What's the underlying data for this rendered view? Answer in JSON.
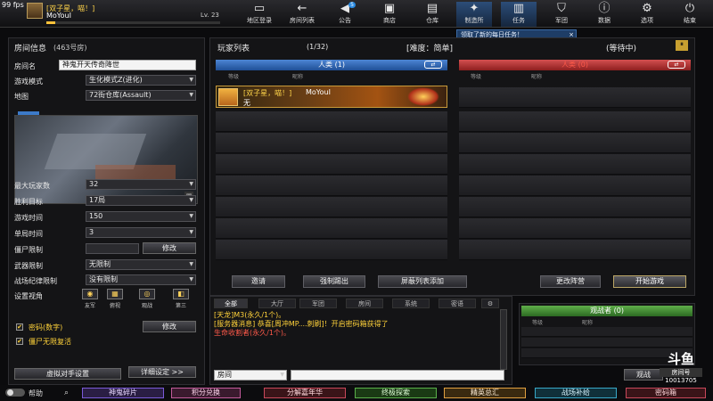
{
  "fps": "99 fps",
  "player": {
    "tag": "[双子星，喵！]",
    "name": "MoYouI",
    "level": "Lv. 23",
    "exp_fraction": 0.05
  },
  "nav": [
    {
      "label": "地区登录",
      "icon": "monitor-icon",
      "glyph": "▭"
    },
    {
      "label": "房间列表",
      "icon": "back-arrow-icon",
      "glyph": "←"
    },
    {
      "label": "公告",
      "icon": "megaphone-icon",
      "glyph": "◀",
      "badge": "5"
    },
    {
      "label": "商店",
      "icon": "shop-icon",
      "glyph": "▣"
    },
    {
      "label": "仓库",
      "icon": "briefcase-icon",
      "glyph": "▤"
    },
    {
      "label": "制造所",
      "icon": "factory-icon",
      "glyph": "✦"
    },
    {
      "label": "任务",
      "icon": "quest-icon",
      "glyph": "▥"
    },
    {
      "label": "军团",
      "icon": "shield-icon",
      "glyph": "⛉"
    },
    {
      "label": "数据",
      "icon": "info-icon",
      "glyph": "ⓘ"
    },
    {
      "label": "选项",
      "icon": "gear-icon",
      "glyph": "⚙"
    },
    {
      "label": "结束",
      "icon": "power-icon",
      "glyph": "⏻"
    }
  ],
  "quest_tip": {
    "text": "领取了新的每日任务！",
    "close": "×"
  },
  "room": {
    "title": "房间信息",
    "room_no": "(463号房)",
    "name_label": "房间名",
    "name_value": "神鬼开天传奇降世",
    "mode_label": "游戏模式",
    "mode_value": "生化模式Z(进化)",
    "map_label": "地图",
    "map_value": "72街仓库(Assault)",
    "max_players_label": "最大玩家数",
    "max_players_value": "32",
    "win_target_label": "胜利目标",
    "win_target_value": "17局",
    "game_time_label": "游戏时间",
    "game_time_value": "150",
    "round_time_label": "单局时间",
    "round_time_value": "3",
    "zombie_limit_label": "僵尸限制",
    "modify_label": "修改",
    "weapon_limit_label": "武器限制",
    "weapon_limit_value": "无限制",
    "discipline_label": "战场纪律限制",
    "discipline_value": "没有限制",
    "view_label": "设置视角",
    "views": [
      "友军",
      "俯视",
      "观战",
      "第三"
    ],
    "password_label": "密码(数字)",
    "password_modify": "修改",
    "zombie_unlimited_label": "僵尸无限复活",
    "bot_settings": "虚拟对手设置",
    "detail_settings": "详细设定 >>"
  },
  "players": {
    "title": "玩家列表",
    "count": "(1/32)",
    "difficulty": "[难度：简单]",
    "status": "(等待中)",
    "pause_icon": "⏸",
    "human_team": "人类 (1)",
    "zombie_team": "人类 (0)",
    "col_rank": "等级",
    "col_name": "昵称",
    "slot_tag": "[双子星，喵！]",
    "slot_name": "MoYouI",
    "slot_line2": "无",
    "invite": "邀请",
    "kick": "强制踢出",
    "block_list": "屏蔽列表添加",
    "change_team": "更改阵营",
    "start_game": "开始游戏"
  },
  "chat": {
    "tabs": [
      "全部",
      "大厅",
      "军团",
      "房间",
      "系统",
      "密语",
      "⚙"
    ],
    "lines": [
      {
        "cls": "gold",
        "text": "[天龙]M3(永久/1个)。"
      },
      {
        "cls": "gold",
        "text": "[服务器消息] 恭喜[周冲MP....刺刷]！开启密码箱获得了"
      },
      {
        "cls": "red",
        "text": "生命收割者(永久/1个)。"
      }
    ],
    "channel": "房间"
  },
  "spectators": {
    "title": "观战者 (0)",
    "col_rank": "等级",
    "col_name": "昵称",
    "more": "观战"
  },
  "bottom": {
    "help": "帮助",
    "buttons": [
      {
        "label": "神鬼碎片",
        "color": "#7a5ad8"
      },
      {
        "label": "积分兑换",
        "color": "#c25a9a"
      },
      {
        "label": "分解嘉年华",
        "color": "#c8485a"
      },
      {
        "label": "终极探索",
        "color": "#5ab04a"
      },
      {
        "label": "精英总汇",
        "color": "#e0a040"
      },
      {
        "label": "战场补给",
        "color": "#38a8c8"
      },
      {
        "label": "密码箱",
        "color": "#c8485a"
      }
    ]
  },
  "watermark": {
    "logo": "斗鱼",
    "room_label": "房间号",
    "room_no": "10013705"
  }
}
